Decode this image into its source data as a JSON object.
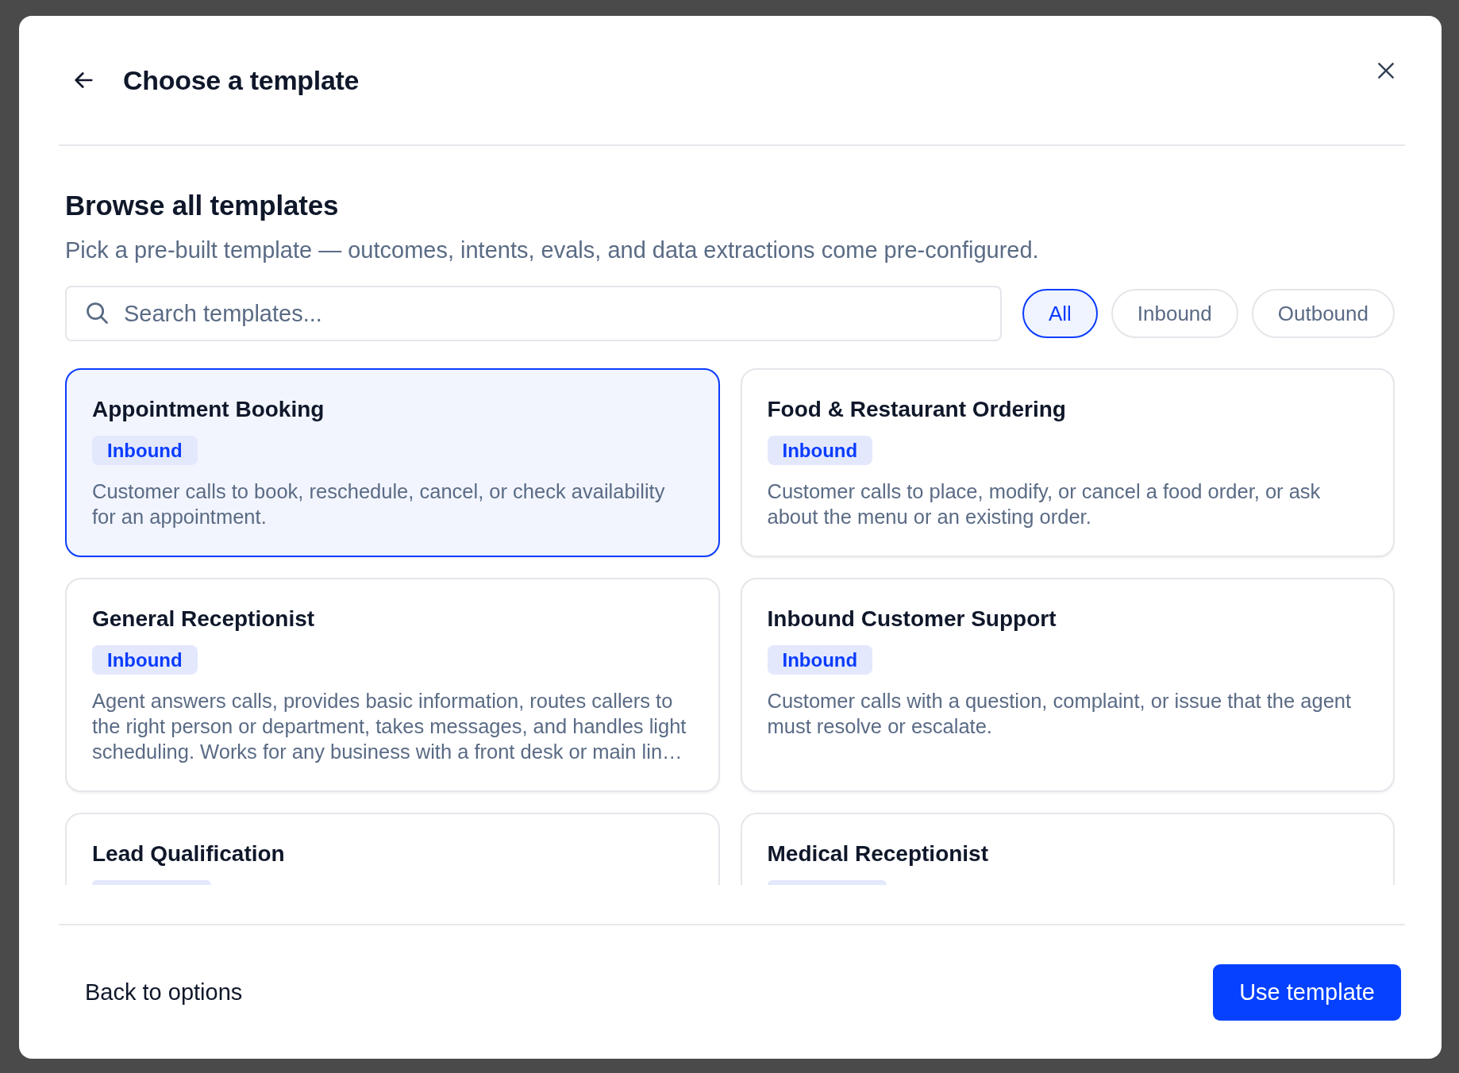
{
  "dialog": {
    "title": "Choose a template"
  },
  "section": {
    "heading": "Browse all templates",
    "description": "Pick a pre-built template — outcomes, intents, evals, and data extractions come pre-configured."
  },
  "search": {
    "placeholder": "Search templates..."
  },
  "filters": [
    {
      "label": "All",
      "selected": true
    },
    {
      "label": "Inbound",
      "selected": false
    },
    {
      "label": "Outbound",
      "selected": false
    }
  ],
  "templates": [
    {
      "kind": "full",
      "name": "Appointment Booking",
      "tag": "Inbound",
      "description": "Customer calls to book, reschedule, cancel, or check availability for an appointment.",
      "selected": true
    },
    {
      "kind": "full",
      "name": "Food & Restaurant Ordering",
      "tag": "Inbound",
      "description": "Customer calls to place, modify, or cancel a food order, or ask about the menu or an existing order.",
      "selected": false
    },
    {
      "kind": "full",
      "name": "General Receptionist",
      "tag": "Inbound",
      "description": "Agent answers calls, provides basic information, routes callers to the right person or department, takes messages, and handles light scheduling. Works for any business with a front desk or main lin…",
      "selected": false
    },
    {
      "kind": "full",
      "name": "Inbound Customer Support",
      "tag": "Inbound",
      "description": "Customer calls with a question, complaint, or issue that the agent must resolve or escalate.",
      "selected": false
    },
    {
      "kind": "cut",
      "name": "Lead Qualification",
      "selected": false
    },
    {
      "kind": "cut",
      "name": "Medical Receptionist",
      "selected": false
    }
  ],
  "footer": {
    "secondary": "Back to options",
    "primary": "Use template"
  }
}
